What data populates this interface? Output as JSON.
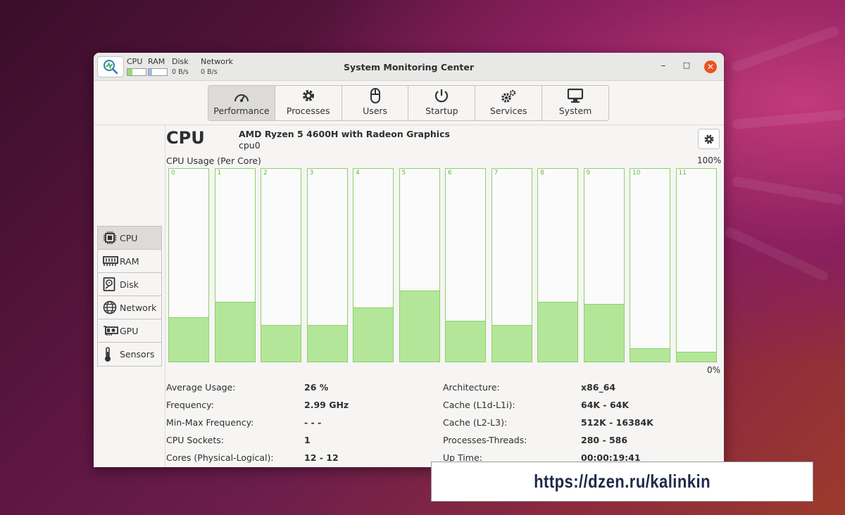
{
  "window": {
    "title": "System Monitoring Center",
    "controls": {
      "minimize": "–",
      "maximize": "□",
      "close": "✕"
    }
  },
  "mini_monitor": {
    "cpu_label": "CPU",
    "ram_label": "RAM",
    "disk_label": "Disk",
    "disk_value": "0 B/s",
    "network_label": "Network",
    "network_value": "0 B/s",
    "cpu_fill": 0.26,
    "ram_fill": 0.18
  },
  "tabs": [
    {
      "label": "Performance",
      "icon": "speedometer-icon",
      "active": true
    },
    {
      "label": "Processes",
      "icon": "gear-icon"
    },
    {
      "label": "Users",
      "icon": "mouse-icon"
    },
    {
      "label": "Startup",
      "icon": "power-icon"
    },
    {
      "label": "Services",
      "icon": "gears-icon"
    },
    {
      "label": "System",
      "icon": "monitor-icon"
    }
  ],
  "sidebar": [
    {
      "label": "CPU",
      "icon": "cpu-chip-icon",
      "active": true
    },
    {
      "label": "RAM",
      "icon": "ram-module-icon"
    },
    {
      "label": "Disk",
      "icon": "hard-disk-icon"
    },
    {
      "label": "Network",
      "icon": "globe-icon"
    },
    {
      "label": "GPU",
      "icon": "graphics-card-icon"
    },
    {
      "label": "Sensors",
      "icon": "thermometer-icon"
    }
  ],
  "cpu": {
    "title": "CPU",
    "model": "AMD Ryzen 5 4600H with Radeon Graphics",
    "device": "cpu0",
    "graph_label": "CPU Usage (Per Core)",
    "max_label": "100%",
    "min_label": "0%"
  },
  "chart_data": {
    "type": "bar",
    "categories": [
      "0",
      "1",
      "2",
      "3",
      "4",
      "5",
      "6",
      "7",
      "8",
      "9",
      "10",
      "11"
    ],
    "values": [
      23,
      31,
      19,
      19,
      28,
      37,
      21,
      19,
      31,
      30,
      7,
      5
    ],
    "ylim": [
      0,
      100
    ],
    "colors": {
      "fill": "#b4e69a",
      "stroke": "#8bd16a"
    }
  },
  "stats": {
    "left": [
      {
        "label": "Average Usage:",
        "value": "26 %"
      },
      {
        "label": "Frequency:",
        "value": "2.99 GHz"
      },
      {
        "label": "Min-Max Frequency:",
        "value": "- - -"
      },
      {
        "label": "CPU Sockets:",
        "value": "1"
      },
      {
        "label": "Cores (Physical-Logical):",
        "value": "12 - 12"
      }
    ],
    "right": [
      {
        "label": "Architecture:",
        "value": "x86_64"
      },
      {
        "label": "Cache (L1d-L1i):",
        "value": "64K - 64K"
      },
      {
        "label": "Cache (L2-L3):",
        "value": "512K - 16384K"
      },
      {
        "label": "Processes-Threads:",
        "value": "280 - 586"
      },
      {
        "label": "Up Time:",
        "value": "00:00:19:41"
      }
    ]
  },
  "watermark": "https://dzen.ru/kalinkin",
  "colors": {
    "accent": "#e95420",
    "graph_stroke": "#8bd16a",
    "graph_fill": "#b4e69a"
  }
}
